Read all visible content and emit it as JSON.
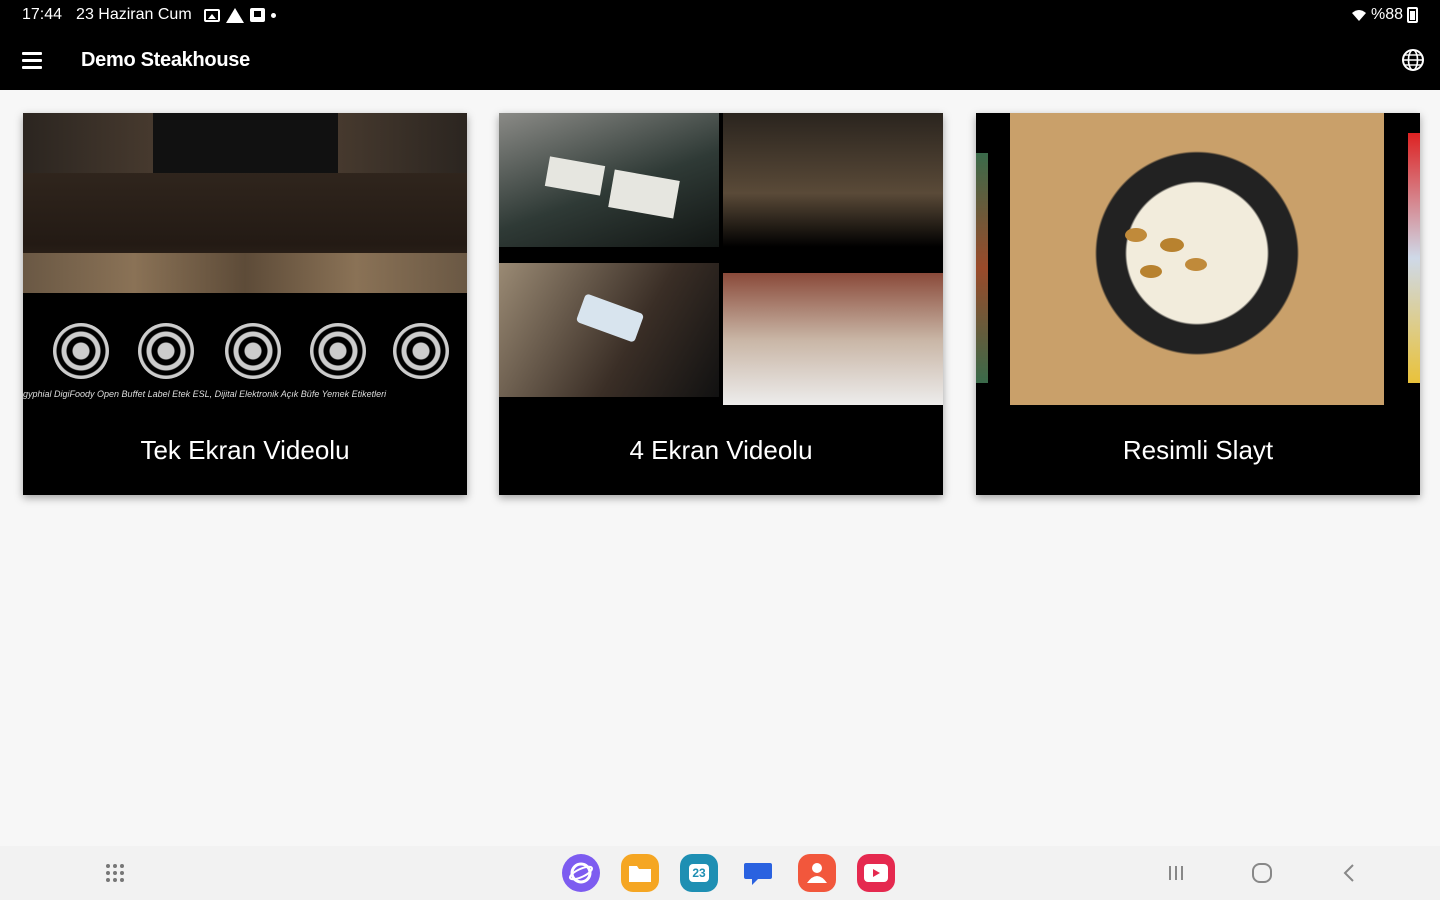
{
  "status_bar": {
    "time": "17:44",
    "date": "23 Haziran Cum",
    "battery": "%88",
    "notification_icons": [
      "gallery-icon",
      "warning-icon",
      "app-icon",
      "dot-icon"
    ]
  },
  "app_bar": {
    "title": "Demo Steakhouse",
    "menu_icon": "hamburger-menu-icon",
    "language_icon": "globe-icon"
  },
  "cards": [
    {
      "label": "Tek Ekran Videolu",
      "ticker_text": "gyphial DigiFoody Open Buffet Label Etek ESL, Dijital Elektronik Açık Büfe Yemek Etiketleri"
    },
    {
      "label": "4 Ekran Videolu"
    },
    {
      "label": "Resimli Slayt"
    }
  ],
  "taskbar": {
    "apps": [
      {
        "name": "samsung-internet-icon",
        "color": "#7d5cf0"
      },
      {
        "name": "my-files-icon",
        "color": "#f5a623"
      },
      {
        "name": "calendar-icon",
        "color": "#1e8fb3",
        "text": "23"
      },
      {
        "name": "messages-icon",
        "color": "#2a62e0"
      },
      {
        "name": "contacts-icon",
        "color": "#f2573c"
      },
      {
        "name": "youtube-icon",
        "color": "#e5294f"
      }
    ],
    "nav": [
      "recents-icon",
      "home-icon",
      "back-icon"
    ]
  },
  "colors": {
    "background": "#f7f7f7",
    "bar": "#000000",
    "card": "#000000"
  }
}
